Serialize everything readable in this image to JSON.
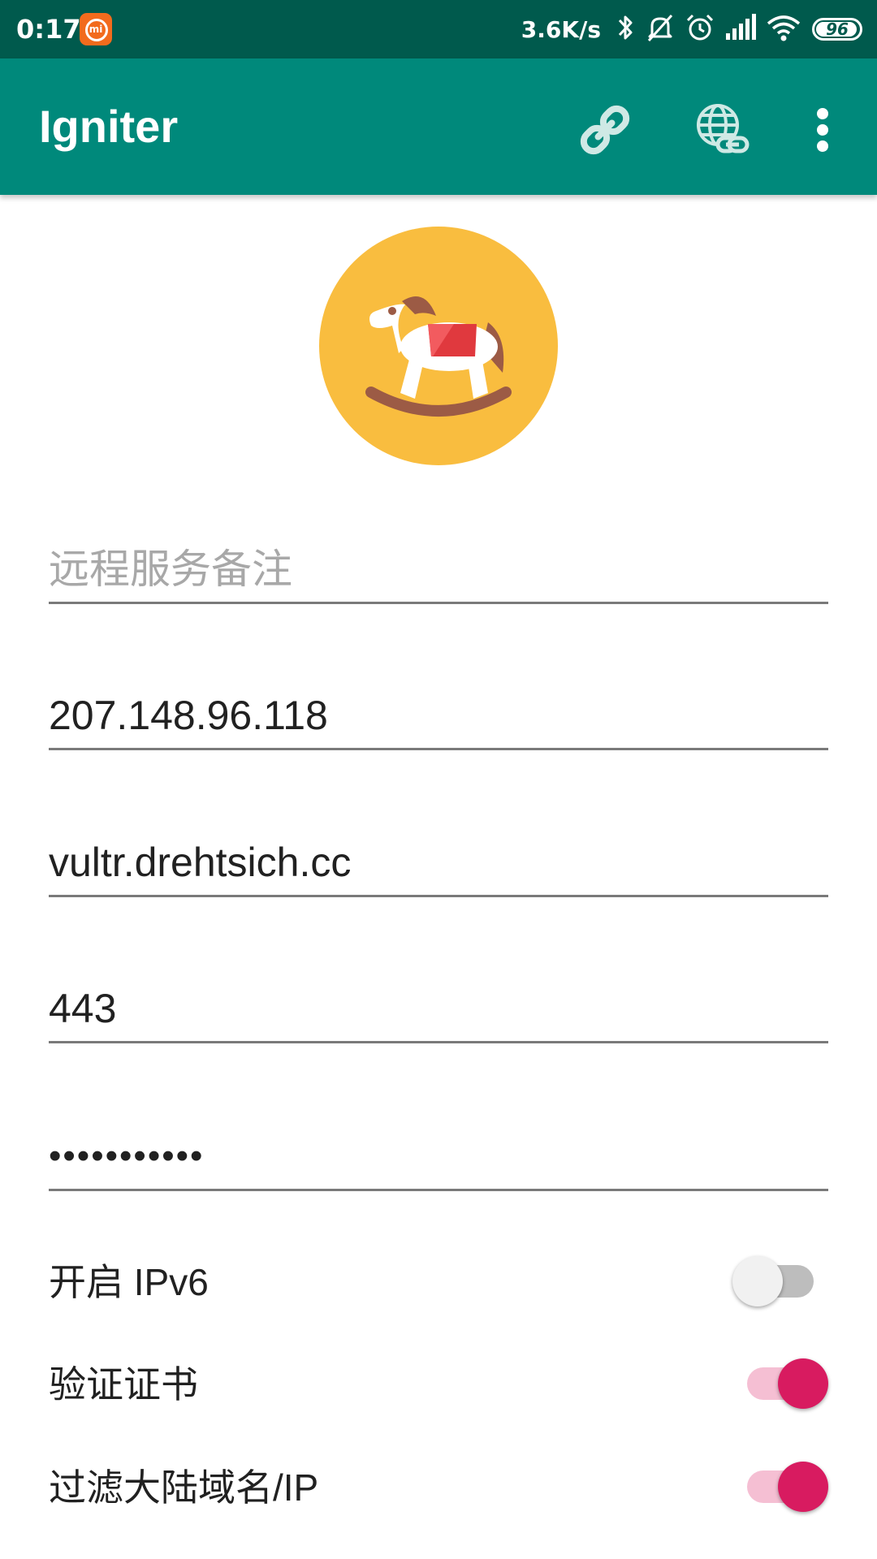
{
  "status_bar": {
    "time": "0:17",
    "mi_badge_text": "mi",
    "net_speed": "3.6K/s",
    "battery_level": "96",
    "icons": [
      "bluetooth-icon",
      "mute-icon",
      "alarm-icon",
      "signal-icon",
      "wifi-icon",
      "battery-icon"
    ]
  },
  "app_bar": {
    "title": "Igniter",
    "actions": [
      "link-icon",
      "globe-link-icon",
      "more-vert-icon"
    ]
  },
  "form": {
    "remark_placeholder": "远程服务备注",
    "remark_value": "",
    "server_ip": "207.148.96.118",
    "domain": "vultr.drehtsich.cc",
    "port": "443",
    "password_masked": "•••••••••••"
  },
  "toggles": [
    {
      "label": "开启 IPv6",
      "checked": false
    },
    {
      "label": "验证证书",
      "checked": true
    },
    {
      "label": "过滤大陆域名/IP",
      "checked": true
    }
  ],
  "colors": {
    "status_bar": "#005a4d",
    "app_bar": "#00897b",
    "accent": "#d81b60",
    "accent_track": "#f5bfd3",
    "logo_circle": "#f9bd3f"
  }
}
